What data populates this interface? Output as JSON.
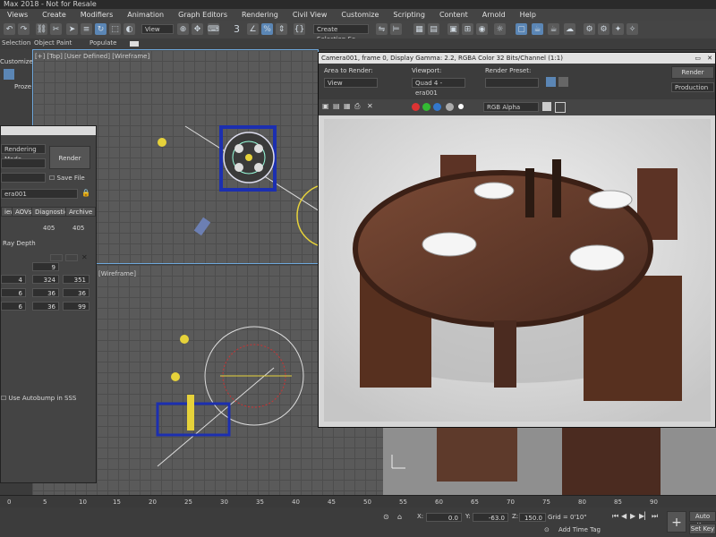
{
  "title_bar": {
    "text": "Max 2018 - Not for Resale"
  },
  "menu": [
    "Views",
    "Create",
    "Modifiers",
    "Animation",
    "Graph Editors",
    "Rendering",
    "Civil View",
    "Customize",
    "Scripting",
    "Content",
    "Arnold",
    "Help"
  ],
  "toolbar": {
    "view_dropdown": "View",
    "snap_label": "3",
    "selection_set": "Create Selection Se"
  },
  "ribbon": {
    "tab1": "Selection",
    "tab2": "Object Paint",
    "tab3": "Populate"
  },
  "viewport_top": {
    "label": "[+] [Top] [User Defined] [Wireframe]"
  },
  "viewport_bottom": {
    "label": "[Wireframe]"
  },
  "left_strip": {
    "label": "Customize",
    "proz": "Proze"
  },
  "render_setup": {
    "rendering_mode": "Rendering Mode",
    "render_button": "Render",
    "save_file": "Save File",
    "camera": "era001",
    "tabs": [
      "iew",
      "AOVs",
      "Diagnostics",
      "Archive"
    ],
    "vals_row1": [
      "405",
      "405"
    ],
    "ray_depth": "Ray Depth",
    "val_9": "9",
    "row_a": [
      "4",
      "324",
      "351"
    ],
    "row_b": [
      "6",
      "36",
      "36"
    ],
    "row_c": [
      "6",
      "36",
      "99"
    ],
    "autobump": "Use Autobump in SSS"
  },
  "render_frame": {
    "title": "Camera001, frame 0, Display Gamma: 2.2, RGBA Color 32 Bits/Channel (1:1)",
    "area_to_render_label": "Area to Render:",
    "area_to_render": "View",
    "viewport_label": "Viewport:",
    "viewport": "Quad 4 - era001",
    "render_preset_label": "Render Preset:",
    "render_preset": "",
    "render_button": "Render",
    "production": "Production",
    "channel": "RGB Alpha"
  },
  "timeline": {
    "ticks": [
      "0",
      "5",
      "10",
      "15",
      "20",
      "25",
      "30",
      "35",
      "40",
      "45",
      "50",
      "55",
      "60",
      "65",
      "70",
      "75",
      "80",
      "85",
      "90"
    ]
  },
  "status": {
    "x": "0.0",
    "y": "-63.0",
    "z": "150.0",
    "grid": "Grid = 0'10\"",
    "add_time_tag": "Add Time Tag",
    "auto_key": "Auto Key",
    "set_key": "Set Key"
  }
}
